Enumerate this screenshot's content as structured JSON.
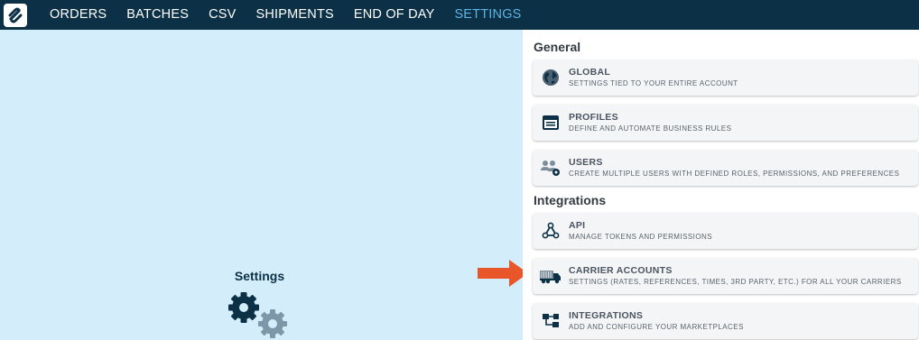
{
  "nav": {
    "logo": "logo-icon",
    "items": [
      "ORDERS",
      "BATCHES",
      "CSV",
      "SHIPMENTS",
      "END OF DAY",
      "SETTINGS"
    ],
    "active": "SETTINGS"
  },
  "left": {
    "title": "Settings",
    "icon": "gears-icon"
  },
  "sections": {
    "general": "General",
    "integrations": "Integrations"
  },
  "cards": {
    "global": {
      "title": "GLOBAL",
      "subtitle": "SETTINGS TIED TO YOUR ENTIRE ACCOUNT",
      "icon": "globe-icon"
    },
    "profiles": {
      "title": "PROFILES",
      "subtitle": "DEFINE AND AUTOMATE BUSINESS RULES",
      "icon": "profile-window-icon"
    },
    "users": {
      "title": "USERS",
      "subtitle": "CREATE MULTIPLE USERS WITH DEFINED ROLES, PERMISSIONS, AND PREFERENCES",
      "icon": "users-gear-icon"
    },
    "api": {
      "title": "API",
      "subtitle": "MANAGE TOKENS AND PERMISSIONS",
      "icon": "webhook-icon"
    },
    "carrier": {
      "title": "CARRIER ACCOUNTS",
      "subtitle": "SETTINGS (RATES, REFERENCES, TIMES, 3RD PARTY, ETC.) FOR ALL YOUR CARRIERS",
      "icon": "truck-icon"
    },
    "integrations": {
      "title": "INTEGRATIONS",
      "subtitle": "ADD AND CONFIGURE YOUR MARKETPLACES",
      "icon": "network-icon"
    }
  },
  "colors": {
    "nav_bg": "#0c3147",
    "nav_active": "#5fb3e3",
    "left_bg": "#d3edfa",
    "arrow": "#e8562a",
    "card_bg": "#f4f5f7",
    "icon_dark": "#0c3147"
  }
}
